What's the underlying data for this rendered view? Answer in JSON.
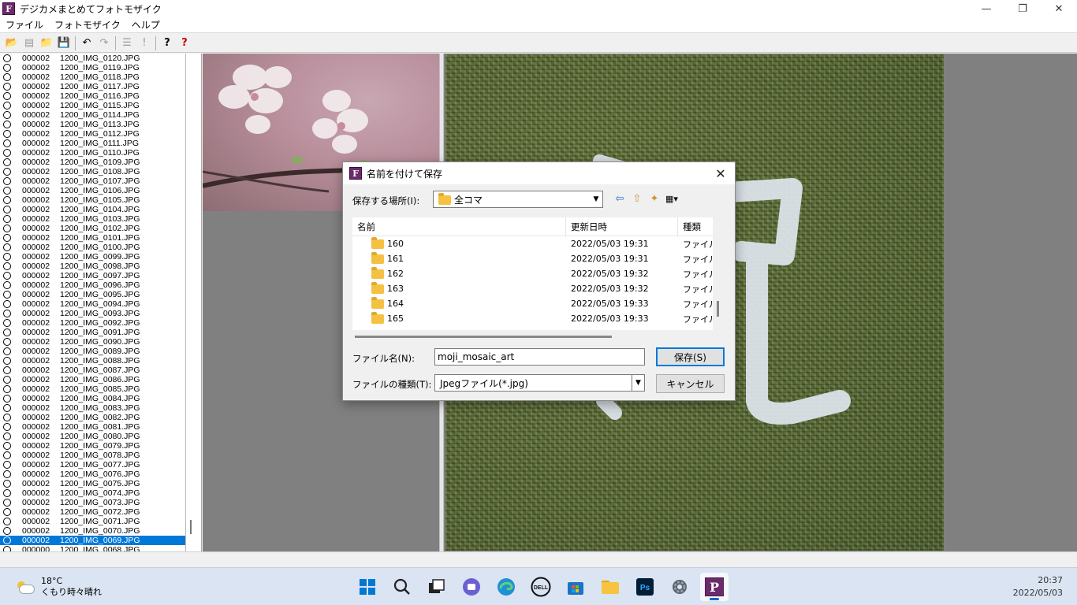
{
  "window": {
    "title": "デジカメまとめてフォトモザイク",
    "icon_letter": "F"
  },
  "window_controls": {
    "minimize": "—",
    "maximize": "❐",
    "close": "✕"
  },
  "menu": [
    "ファイル",
    "フォトモザイク",
    "ヘルプ"
  ],
  "toolbar": {
    "glyphs": [
      "📂",
      "▤",
      "📁",
      "💾",
      "↶",
      "↷",
      "☰",
      "!",
      "?",
      "?"
    ]
  },
  "file_list": {
    "rows": [
      {
        "id": "000002",
        "name": "1200_IMG_0120.JPG"
      },
      {
        "id": "000002",
        "name": "1200_IMG_0119.JPG"
      },
      {
        "id": "000002",
        "name": "1200_IMG_0118.JPG"
      },
      {
        "id": "000002",
        "name": "1200_IMG_0117.JPG"
      },
      {
        "id": "000002",
        "name": "1200_IMG_0116.JPG"
      },
      {
        "id": "000002",
        "name": "1200_IMG_0115.JPG"
      },
      {
        "id": "000002",
        "name": "1200_IMG_0114.JPG"
      },
      {
        "id": "000002",
        "name": "1200_IMG_0113.JPG"
      },
      {
        "id": "000002",
        "name": "1200_IMG_0112.JPG"
      },
      {
        "id": "000002",
        "name": "1200_IMG_0111.JPG"
      },
      {
        "id": "000002",
        "name": "1200_IMG_0110.JPG"
      },
      {
        "id": "000002",
        "name": "1200_IMG_0109.JPG"
      },
      {
        "id": "000002",
        "name": "1200_IMG_0108.JPG"
      },
      {
        "id": "000002",
        "name": "1200_IMG_0107.JPG"
      },
      {
        "id": "000002",
        "name": "1200_IMG_0106.JPG"
      },
      {
        "id": "000002",
        "name": "1200_IMG_0105.JPG"
      },
      {
        "id": "000002",
        "name": "1200_IMG_0104.JPG"
      },
      {
        "id": "000002",
        "name": "1200_IMG_0103.JPG"
      },
      {
        "id": "000002",
        "name": "1200_IMG_0102.JPG"
      },
      {
        "id": "000002",
        "name": "1200_IMG_0101.JPG"
      },
      {
        "id": "000002",
        "name": "1200_IMG_0100.JPG"
      },
      {
        "id": "000002",
        "name": "1200_IMG_0099.JPG"
      },
      {
        "id": "000002",
        "name": "1200_IMG_0098.JPG"
      },
      {
        "id": "000002",
        "name": "1200_IMG_0097.JPG"
      },
      {
        "id": "000002",
        "name": "1200_IMG_0096.JPG"
      },
      {
        "id": "000002",
        "name": "1200_IMG_0095.JPG"
      },
      {
        "id": "000002",
        "name": "1200_IMG_0094.JPG"
      },
      {
        "id": "000002",
        "name": "1200_IMG_0093.JPG"
      },
      {
        "id": "000002",
        "name": "1200_IMG_0092.JPG"
      },
      {
        "id": "000002",
        "name": "1200_IMG_0091.JPG"
      },
      {
        "id": "000002",
        "name": "1200_IMG_0090.JPG"
      },
      {
        "id": "000002",
        "name": "1200_IMG_0089.JPG"
      },
      {
        "id": "000002",
        "name": "1200_IMG_0088.JPG"
      },
      {
        "id": "000002",
        "name": "1200_IMG_0087.JPG"
      },
      {
        "id": "000002",
        "name": "1200_IMG_0086.JPG"
      },
      {
        "id": "000002",
        "name": "1200_IMG_0085.JPG"
      },
      {
        "id": "000002",
        "name": "1200_IMG_0084.JPG"
      },
      {
        "id": "000002",
        "name": "1200_IMG_0083.JPG"
      },
      {
        "id": "000002",
        "name": "1200_IMG_0082.JPG"
      },
      {
        "id": "000002",
        "name": "1200_IMG_0081.JPG"
      },
      {
        "id": "000002",
        "name": "1200_IMG_0080.JPG"
      },
      {
        "id": "000002",
        "name": "1200_IMG_0079.JPG"
      },
      {
        "id": "000002",
        "name": "1200_IMG_0078.JPG"
      },
      {
        "id": "000002",
        "name": "1200_IMG_0077.JPG"
      },
      {
        "id": "000002",
        "name": "1200_IMG_0076.JPG"
      },
      {
        "id": "000002",
        "name": "1200_IMG_0075.JPG"
      },
      {
        "id": "000002",
        "name": "1200_IMG_0074.JPG"
      },
      {
        "id": "000002",
        "name": "1200_IMG_0073.JPG"
      },
      {
        "id": "000002",
        "name": "1200_IMG_0072.JPG"
      },
      {
        "id": "000002",
        "name": "1200_IMG_0071.JPG"
      },
      {
        "id": "000002",
        "name": "1200_IMG_0070.JPG"
      },
      {
        "id": "000002",
        "name": "1200_IMG_0069.JPG"
      },
      {
        "id": "000000",
        "name": "1200_IMG_0068.JPG"
      }
    ],
    "selected_name": "1200_IMG_0069.JPG"
  },
  "dialog": {
    "title": "名前を付けて保存",
    "close_glyph": "✕",
    "save_in_label": "保存する場所(I):",
    "save_in_value": "全コマ",
    "nav_glyphs": [
      "⇦",
      "⇧",
      "✦",
      "▦▾"
    ],
    "columns": [
      "名前",
      "更新日時",
      "種類"
    ],
    "sort_caret": "^",
    "rows": [
      {
        "name": "160",
        "date": "2022/05/03 19:31",
        "type": "ファイル"
      },
      {
        "name": "161",
        "date": "2022/05/03 19:31",
        "type": "ファイル"
      },
      {
        "name": "162",
        "date": "2022/05/03 19:32",
        "type": "ファイル"
      },
      {
        "name": "163",
        "date": "2022/05/03 19:32",
        "type": "ファイル"
      },
      {
        "name": "164",
        "date": "2022/05/03 19:33",
        "type": "ファイル"
      },
      {
        "name": "165",
        "date": "2022/05/03 19:33",
        "type": "ファイル"
      }
    ],
    "filename_label": "ファイル名(N):",
    "filename_value": "moji_mosaic_art",
    "filetype_label": "ファイルの種類(T):",
    "filetype_value": "Jpegファイル(*.jpg)",
    "save_button": "保存(S)",
    "cancel_button": "キャンセル"
  },
  "taskbar": {
    "weather_temp": "18°C",
    "weather_desc": "くもり時々晴れ",
    "time": "20:37",
    "date": "2022/05/03",
    "apps": [
      "start",
      "search",
      "task-view",
      "chat",
      "edge",
      "dell",
      "store",
      "explorer",
      "photoshop",
      "settings",
      "photomosaic"
    ],
    "ps_label": "Ps",
    "dell_label": "DELL",
    "pm_label": "P"
  }
}
